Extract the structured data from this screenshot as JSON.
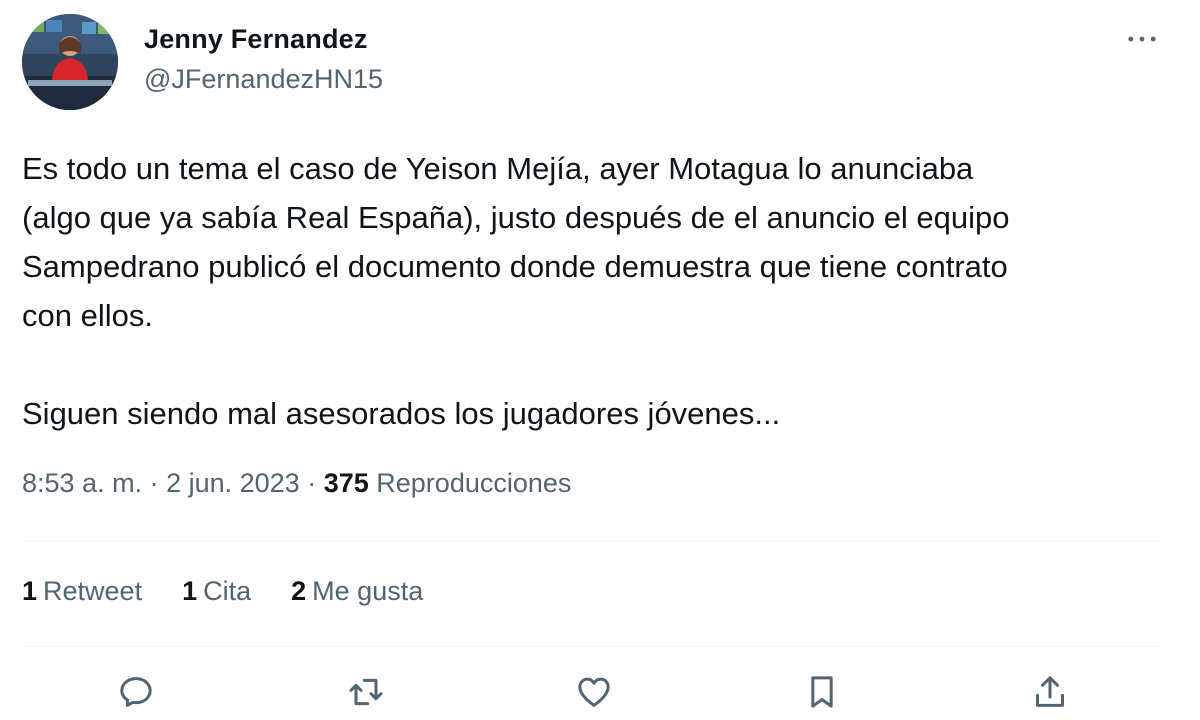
{
  "author": {
    "display_name": "Jenny Fernandez",
    "handle": "@JFernandezHN15"
  },
  "tweet": {
    "paragraph_1_lines": [
      "Es todo un tema el caso de Yeison Mejía, ayer Motagua lo anunciaba",
      "(algo que ya sabía Real España), justo después de el anuncio el equipo",
      "Sampedrano publicó el documento donde demuestra que tiene contrato",
      "con ellos."
    ],
    "paragraph_2": "Siguen siendo mal asesorados los jugadores jóvenes..."
  },
  "meta": {
    "time": "8:53 a. m.",
    "separator": " · ",
    "date": "2 jun. 2023",
    "views_count": "375",
    "views_label": "Reproducciones"
  },
  "stats": {
    "retweets_count": "1",
    "retweets_label": "Retweet",
    "quotes_count": "1",
    "quotes_label": "Cita",
    "likes_count": "2",
    "likes_label": "Me gusta"
  },
  "icons": {
    "more": "more-horizontal-icon",
    "reply": "reply-icon",
    "retweet": "retweet-icon",
    "like": "heart-icon",
    "bookmark": "bookmark-icon",
    "share": "share-icon"
  },
  "colors": {
    "text": "#0f1419",
    "secondary": "#536471",
    "divider": "#eff3f4"
  }
}
